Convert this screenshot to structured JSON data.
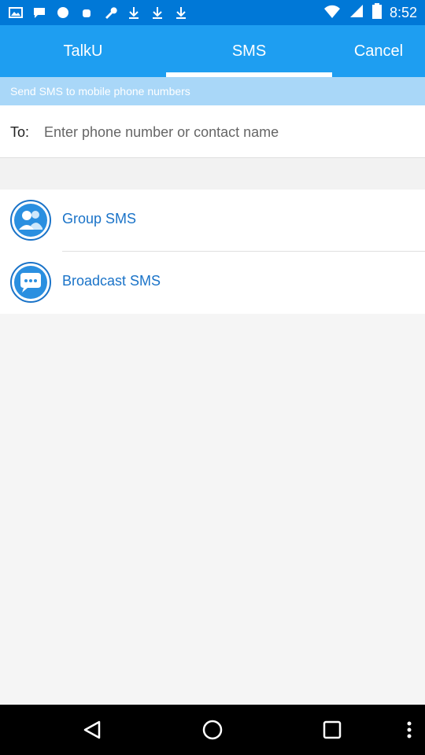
{
  "status_bar": {
    "time": "8:52",
    "left_icons": [
      "photo-icon",
      "chat-icon",
      "game-icon",
      "android-debug-icon",
      "wrench-icon",
      "download-icon",
      "download-icon",
      "download-icon"
    ],
    "right_icons": [
      "wifi-icon",
      "signal-icon",
      "battery-icon"
    ]
  },
  "header": {
    "tabs": [
      {
        "label": "TalkU",
        "selected": false
      },
      {
        "label": "SMS",
        "selected": true
      }
    ],
    "cancel_label": "Cancel",
    "accent_color": "#1e9ef1"
  },
  "subtitle": "Send SMS to mobile phone numbers",
  "recipient": {
    "label": "To:",
    "value": "",
    "placeholder": "Enter phone number or contact name"
  },
  "options": [
    {
      "label": "Group SMS",
      "icon": "group-icon"
    },
    {
      "label": "Broadcast SMS",
      "icon": "chat-bubble-icon"
    }
  ],
  "nav_bar": {
    "buttons": [
      "back-icon",
      "home-icon",
      "recent-apps-icon",
      "overflow-menu-icon"
    ]
  }
}
